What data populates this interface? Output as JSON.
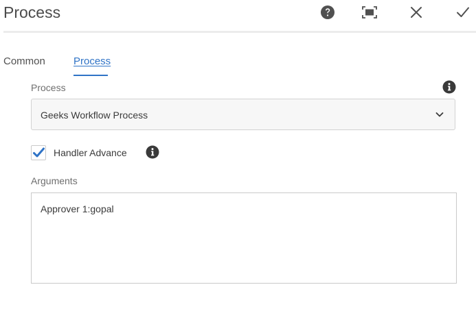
{
  "dialog": {
    "title": "Process",
    "actions": {
      "help_icon": "help-circle-icon",
      "fullscreen_icon": "fullscreen-icon",
      "close_icon": "close-icon",
      "confirm_icon": "checkmark-icon"
    }
  },
  "tabs": [
    {
      "label": "Common",
      "active": false
    },
    {
      "label": "Process",
      "active": true
    }
  ],
  "form": {
    "process_label": "Process",
    "process_info_icon": "info-icon",
    "process_select": {
      "value": "Geeks Workflow Process",
      "icon": "chevron-down-icon"
    },
    "handler_advance": {
      "label": "Handler Advance",
      "checked": true,
      "info_icon": "info-icon"
    },
    "arguments_label": "Arguments",
    "arguments_value": "Approver 1:gopal"
  },
  "colors": {
    "accent": "#2f73c6",
    "text": "#4b4b4b",
    "icon": "#505050"
  }
}
